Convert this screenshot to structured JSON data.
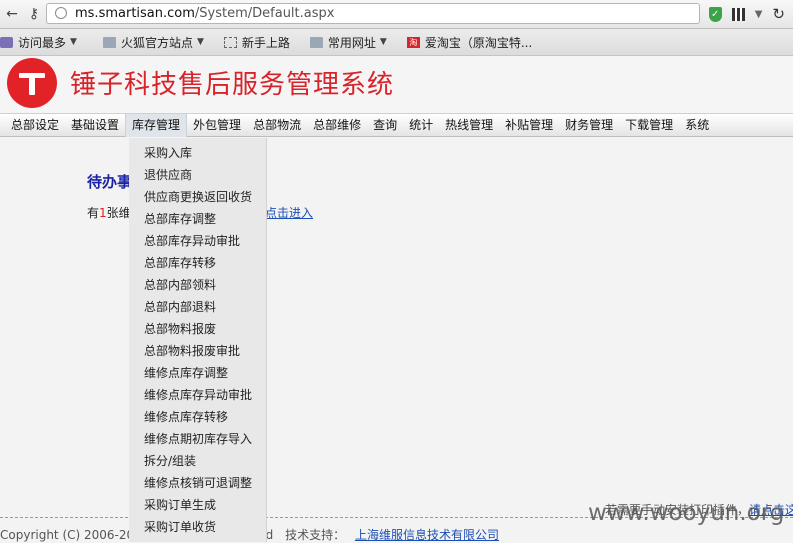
{
  "browser": {
    "url_host": "ms.smartisan.com",
    "url_path": "/System/Default.aspx"
  },
  "bookmarks": [
    {
      "label": "访问最多",
      "icon": "recent-icon",
      "caret": true
    },
    {
      "label": "火狐官方站点",
      "icon": "folder-icon",
      "caret": true
    },
    {
      "label": "新手上路",
      "icon": "page-icon",
      "caret": false
    },
    {
      "label": "常用网址",
      "icon": "folder-icon",
      "caret": true
    },
    {
      "label": "爱淘宝（原淘宝特...",
      "icon": "taobao-icon",
      "caret": false
    }
  ],
  "header": {
    "title": "锤子科技售后服务管理系统",
    "brand_color": "#d8232a"
  },
  "menu": [
    "总部设定",
    "基础设置",
    "库存管理",
    "外包管理",
    "总部物流",
    "总部维修",
    "查询",
    "统计",
    "热线管理",
    "补贴管理",
    "财务管理",
    "下载管理",
    "系统"
  ],
  "dropdown": [
    "采购入库",
    "退供应商",
    "供应商更换返回收货",
    "总部库存调整",
    "总部库存异动审批",
    "总部库存转移",
    "总部内部领料",
    "总部内部退料",
    "总部物料报废",
    "总部物料报废审批",
    "维修点库存调整",
    "维修点库存异动审批",
    "维修点库存转移",
    "维修点期初库存导入",
    "拆分/组装",
    "维修点核销可退调整",
    "采购订单生成",
    "采购订单收货"
  ],
  "main": {
    "section_title": "待办事",
    "notice_prefix": "有",
    "notice_count": "1",
    "notice_suffix": "张维",
    "notice_link": "点击进入"
  },
  "footer": {
    "print_hint": "若需要手动安装打印插件，",
    "print_link": "请点击这",
    "copyright": "Copyright (C) 2006-2012, All Rights Reserved",
    "support_label": "技术支持：",
    "support_link": "上海维服信息技术有限公司",
    "watermark": "www.wooyun.org"
  }
}
